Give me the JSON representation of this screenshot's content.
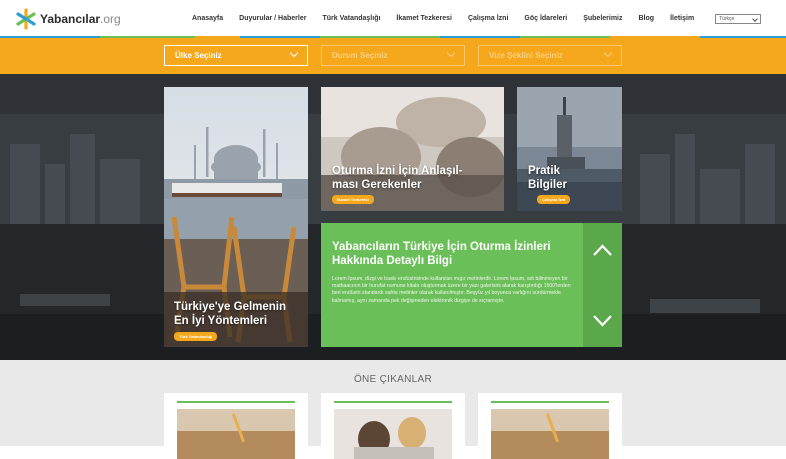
{
  "brand": {
    "name": "Yabancılar",
    "tld": ".org"
  },
  "nav": [
    "Anasayfa",
    "Duyurular / Haberler",
    "Türk Vatandaşlığı",
    "İkamet Tezkeresi",
    "Çalışma İzni",
    "Göç İdareleri",
    "Şubelerimiz",
    "Blog",
    "İletişim"
  ],
  "language": "Türkçe",
  "filters": {
    "country": "Ülke Seçiniz",
    "status": "Durum Seçiniz",
    "visa": "Vize Şeklini Seçiniz"
  },
  "cards": {
    "istanbul": {
      "title_line1": "Türkiye'ye Gelmenin",
      "title_line2": "En İyi Yöntemleri",
      "tag": "Türk Vatandaşlığı"
    },
    "residence": {
      "title_line1": "Oturma İzni İçin Anlaşıl-",
      "title_line2": "ması Gerekenler",
      "tag": "İkamet Tezkeresi"
    },
    "practical": {
      "title_line1": "Pratik",
      "title_line2": "Bilgiler",
      "tag": "Çalışma İzni"
    }
  },
  "feature": {
    "title": "Yabancıların Türkiye İçin Oturma İzinleri Hakkında Detaylı Bilgi",
    "body": "Lorem Ipsum, dizgi ve baskı endüstrisinde kullanılan mıgır metinlerdir. Lorem Ipsum, adı bilinmeyen bir matbaacının bir hurufat numune kitabı oluşturmak üzere bir yazı galerisini alarak karıştırdığı 1500'lerden beri endüstri standardı sahte metinler olarak kullanılmıştır. Beşyüz yıl boyunca varlığını sürdürmekle kalmamış, aynı zamanda pek değişmeden elektronik dizgiye de sıçramıştır."
  },
  "highlights": {
    "title": "ÖNE ÇIKANLAR"
  },
  "colors": {
    "orange": "#f6a81c",
    "green": "#6bbf59",
    "dark_green": "#5aa849",
    "blue": "#2a9fd6"
  }
}
